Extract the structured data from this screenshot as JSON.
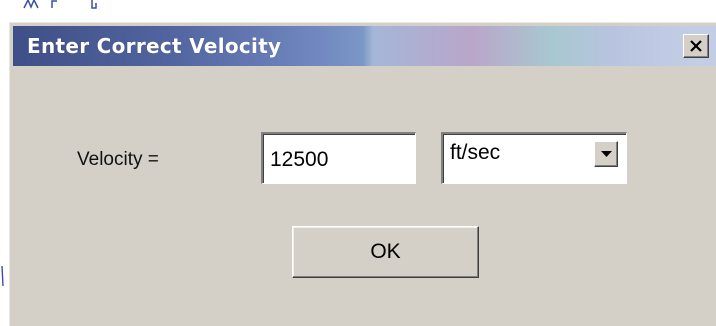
{
  "dialog": {
    "title": "Enter Correct Velocity",
    "close_icon": "close-icon",
    "velocity_label": "Velocity =",
    "velocity_value": "12500",
    "unit_selected": "ft/sec",
    "dropdown_icon": "chevron-down-icon",
    "ok_label": "OK"
  },
  "colors": {
    "dialog_background": "#d4d0c8",
    "titlebar_start": "#3f4f87",
    "titlebar_end": "#c4cde6",
    "title_text": "#ffffff"
  }
}
